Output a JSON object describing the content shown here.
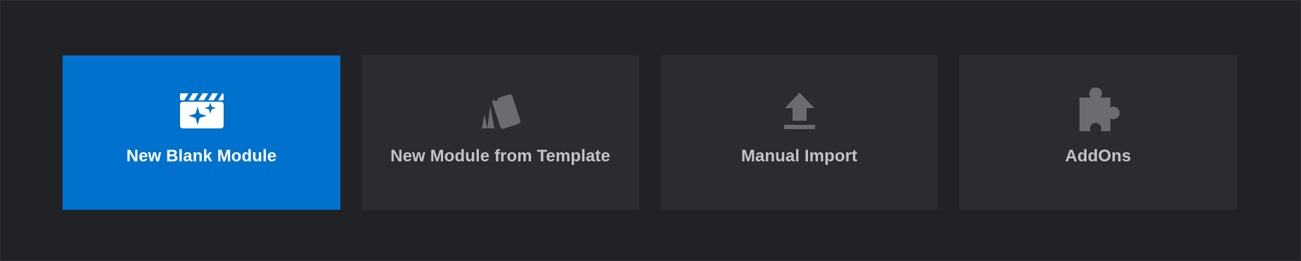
{
  "cards": [
    {
      "label": "New Blank Module",
      "icon": "clapperboard-sparkle-icon",
      "selected": true
    },
    {
      "label": "New Module from Template",
      "icon": "template-cards-icon",
      "selected": false
    },
    {
      "label": "Manual Import",
      "icon": "upload-icon",
      "selected": false
    },
    {
      "label": "AddOns",
      "icon": "puzzle-icon",
      "selected": false
    }
  ],
  "colors": {
    "background": "#212225",
    "card": "#2b2c30",
    "card_selected": "#0071cd",
    "icon_inactive": "#6b6c70",
    "label_inactive": "#c2c3c7",
    "label_selected": "#ffffff"
  }
}
